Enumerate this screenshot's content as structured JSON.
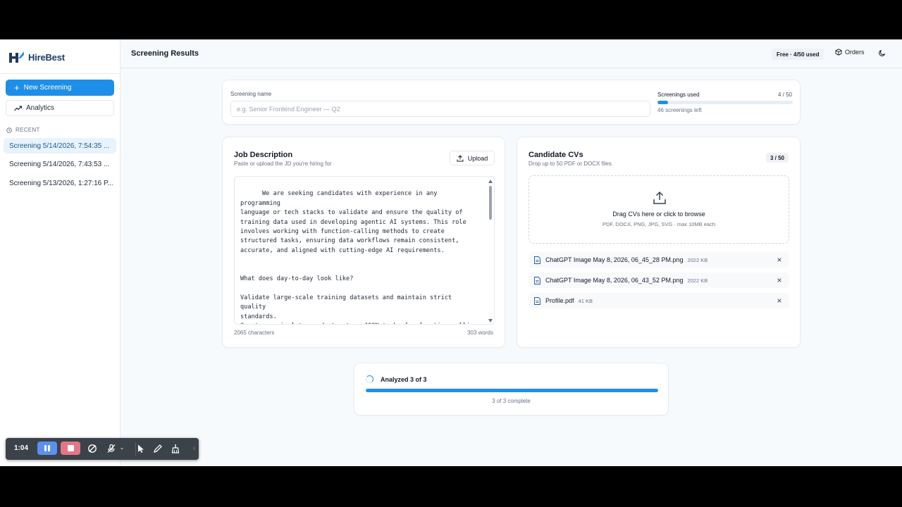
{
  "app": {
    "brand": "HireBest"
  },
  "sidebar": {
    "new_screening": "New Screening",
    "analytics": "Analytics",
    "recent_label": "RECENT",
    "recent": [
      "Screening 5/14/2026, 7:54:35 ...",
      "Screening 5/14/2026, 7:43:53 ...",
      "Screening 5/13/2026, 1:27:16 P..."
    ]
  },
  "header": {
    "title": "Screening Results",
    "plan": "Free · 4/50 used",
    "orders": "Orders"
  },
  "screening": {
    "name_label": "Screening name",
    "name_placeholder": "e.g. Senior Frontend Engineer — Q2",
    "usage_label": "Screenings used",
    "usage_count": "4 / 50",
    "usage_fraction": 0.08,
    "usage_left": "46 screenings left"
  },
  "jd": {
    "title": "Job Description",
    "subtitle": "Paste or upload the JD you're hiring for",
    "upload": "Upload",
    "text": "We are seeking candidates with experience in any programming\nlanguage or tech stacks to validate and ensure the quality of\ntraining data used in developing agentic AI systems. This role\ninvolves working with function-calling methods to create\nstructured tasks, ensuring data workflows remain consistent,\naccurate, and aligned with cutting-edge AI requirements.\n\n\nWhat does day-to-day look like?\n\nValidate large-scale training datasets and maintain strict quality\nstandards.\nCreate, manipulate, and structure JSON tasks for function-calling\nworkflows.\nWork closely with AI researchers and teams to align datasets with\nagentic AI use cases.",
    "characters": "2065 characters",
    "words": "303 words"
  },
  "cvs": {
    "title": "Candidate CVs",
    "subtitle": "Drop up to 50 PDF or DOCX files",
    "count": "3 / 50",
    "drop_title": "Drag CVs here or click to browse",
    "drop_sub": "PDF, DOCX, PNG, JPG, SVG · max 10MB each",
    "files": [
      {
        "name": "ChatGPT Image May 8, 2026, 06_45_28 PM.png",
        "size": "2022 KB"
      },
      {
        "name": "ChatGPT Image May 8, 2026, 06_43_52 PM.png",
        "size": "2022 KB"
      },
      {
        "name": "Profile.pdf",
        "size": "41 KB"
      }
    ]
  },
  "progress": {
    "title": "Analyzed 3 of 3",
    "fraction": 1.0,
    "subtitle": "3 of 3 complete"
  },
  "recorder": {
    "time": "1:04"
  },
  "colors": {
    "accent": "#1e8fe8",
    "brand_dark": "#1e3a5f"
  }
}
